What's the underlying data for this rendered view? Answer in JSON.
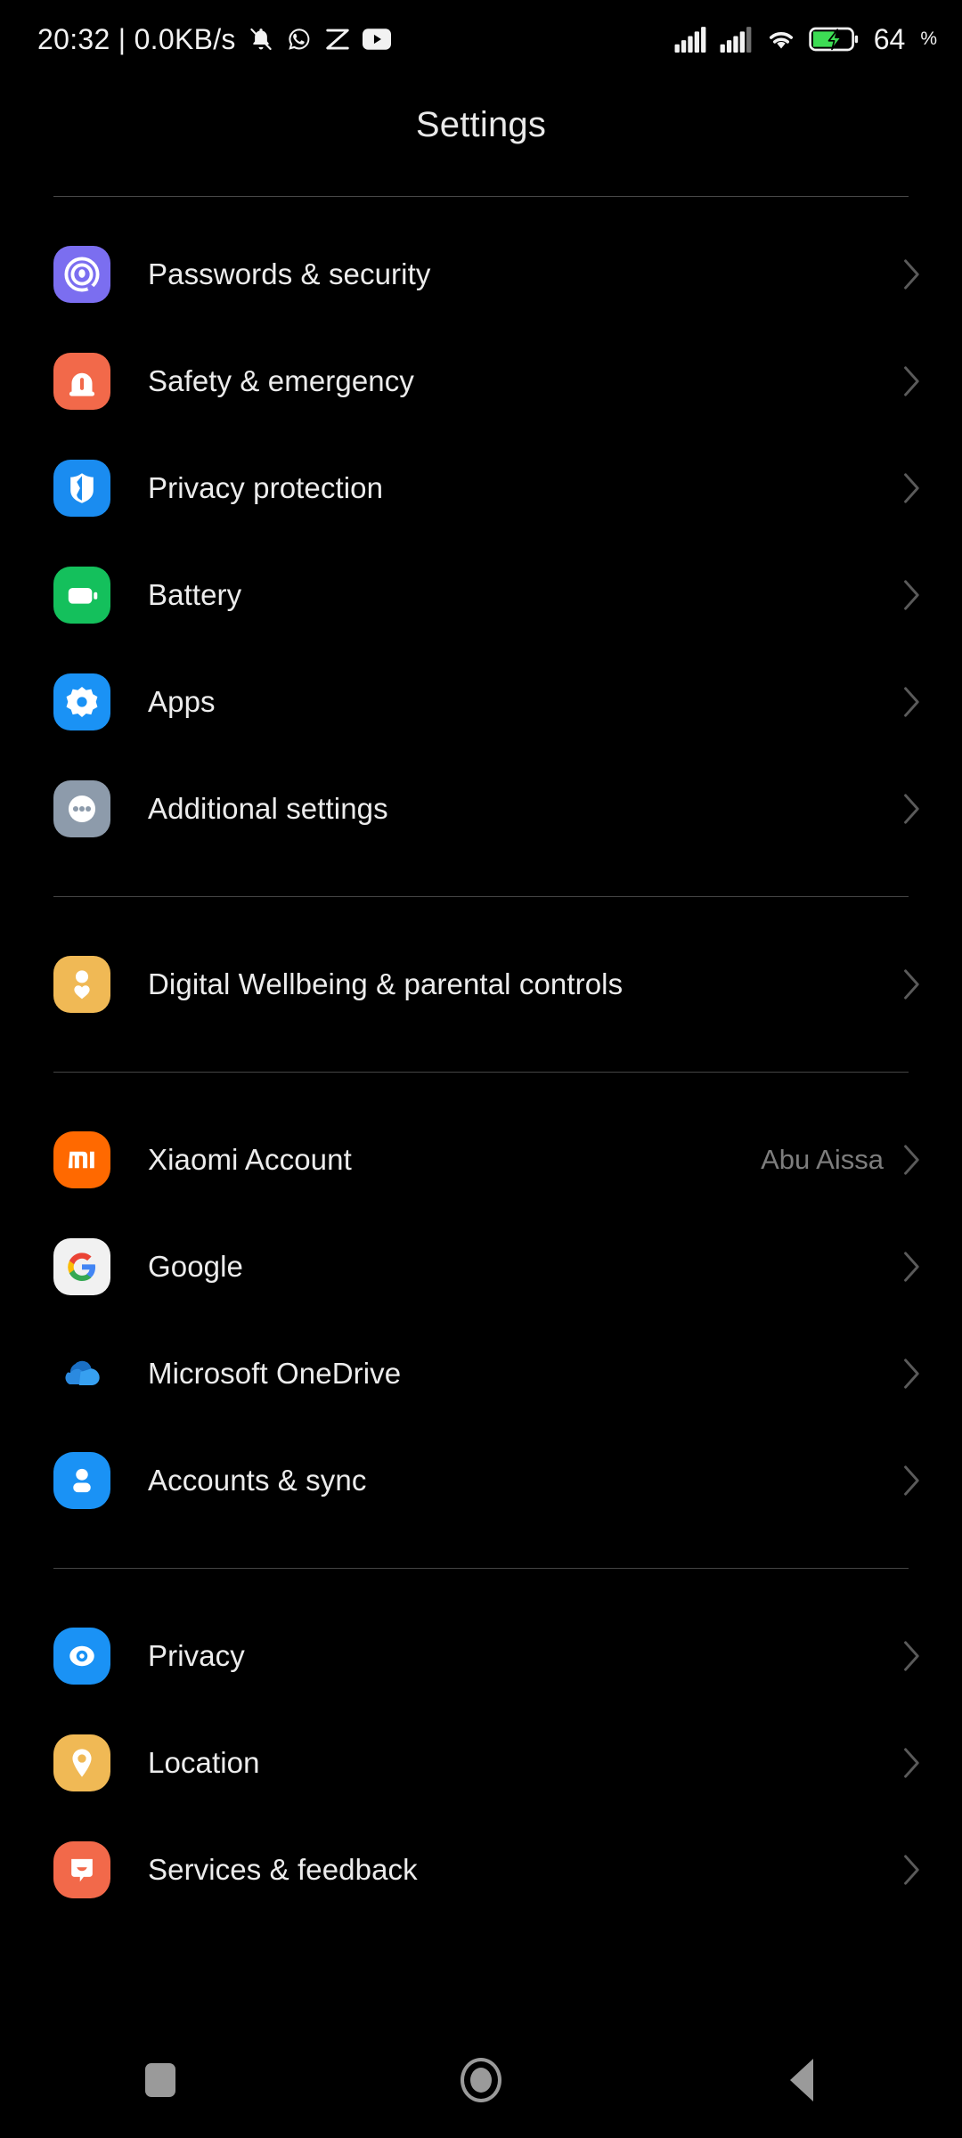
{
  "status_bar": {
    "clock": "20:32 | 0.0KB/s",
    "left_icons": [
      "bell-muted-icon",
      "whatsapp-icon",
      "capcut-icon",
      "youtube-icon"
    ],
    "right_icons": [
      "signal-bars-sim1-icon",
      "signal-bars-sim2-icon",
      "wifi-icon",
      "battery-charging-icon"
    ],
    "battery_percent": "64",
    "battery_percent_symbol": "%"
  },
  "header": {
    "title": "Settings"
  },
  "groups": [
    {
      "items": [
        {
          "label": "Passwords & security",
          "icon": "fingerprint-icon",
          "color": "#7b6ef0",
          "value": ""
        },
        {
          "label": "Safety & emergency",
          "icon": "siren-icon",
          "color": "#f2694a",
          "value": ""
        },
        {
          "label": "Privacy protection",
          "icon": "shield-icon",
          "color": "#1a8cf0",
          "value": ""
        },
        {
          "label": "Battery",
          "icon": "battery-icon",
          "color": "#14c05c",
          "value": ""
        },
        {
          "label": "Apps",
          "icon": "apps-gear-icon",
          "color": "#1a92f5",
          "value": ""
        },
        {
          "label": "Additional settings",
          "icon": "more-dots-icon",
          "color": "#8d9bab",
          "value": ""
        }
      ]
    },
    {
      "items": [
        {
          "label": "Digital Wellbeing & parental controls",
          "icon": "wellbeing-icon",
          "color": "#f0b955",
          "value": ""
        }
      ]
    },
    {
      "items": [
        {
          "label": "Xiaomi Account",
          "icon": "mi-logo-icon",
          "color": "#ff6900",
          "value": "Abu Aissa"
        },
        {
          "label": "Google",
          "icon": "google-g-icon",
          "color": "#f1f1f1",
          "value": ""
        },
        {
          "label": "Microsoft OneDrive",
          "icon": "onedrive-cloud-icon",
          "color": "#000000",
          "value": ""
        },
        {
          "label": "Accounts & sync",
          "icon": "account-person-icon",
          "color": "#1a92f5",
          "value": ""
        }
      ]
    },
    {
      "items": [
        {
          "label": "Privacy",
          "icon": "eye-icon",
          "color": "#1a92f5",
          "value": ""
        },
        {
          "label": "Location",
          "icon": "location-pin-icon",
          "color": "#f0b955",
          "value": ""
        },
        {
          "label": "Services & feedback",
          "icon": "feedback-bubble-icon",
          "color": "#f2694a",
          "value": ""
        }
      ]
    }
  ],
  "nav_bar": {
    "recents": "recents-square-icon",
    "home": "home-circle-icon",
    "back": "back-triangle-icon"
  }
}
